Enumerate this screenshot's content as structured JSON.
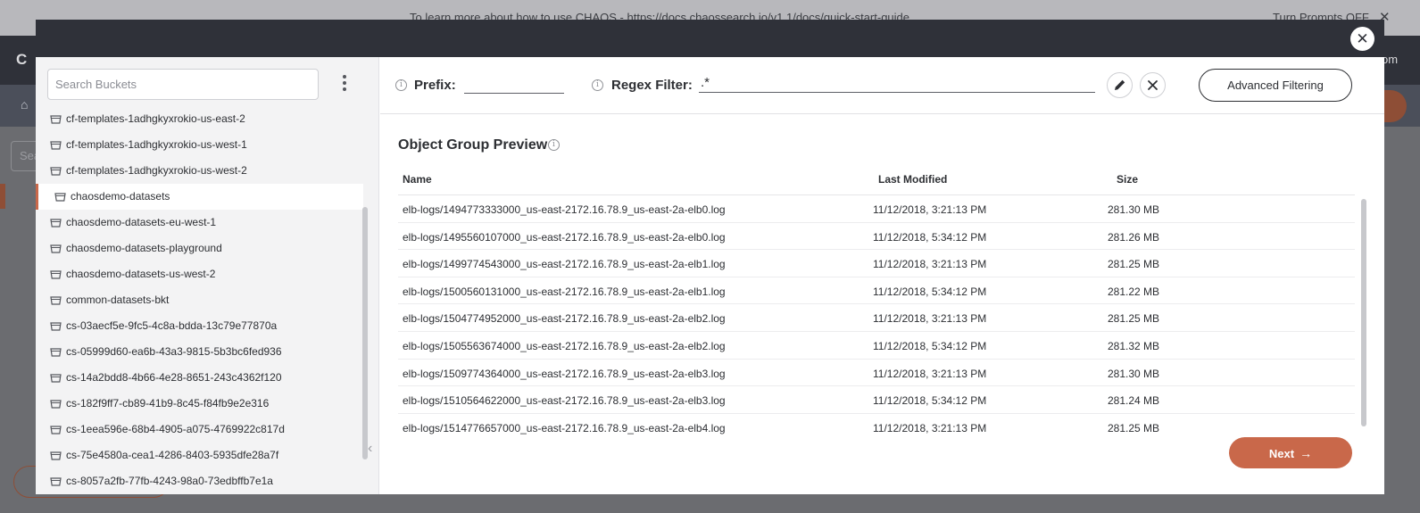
{
  "background": {
    "announcement": "To learn more about how to use CHAOS - https://docs.chaossearch.io/v1.1/docs/quick-start-guide",
    "prompts_toggle": "Turn Prompts OFF",
    "brand": "C H",
    "nav_right_fragment": "om",
    "search_fragment": "Sea"
  },
  "modal": {
    "close_icon": "close-icon",
    "search": {
      "placeholder": "Search Buckets",
      "value": ""
    },
    "buckets": [
      "cf-templates-1adhgkyxrokio-us-east-2",
      "cf-templates-1adhgkyxrokio-us-west-1",
      "cf-templates-1adhgkyxrokio-us-west-2",
      "chaosdemo-datasets",
      "chaosdemo-datasets-eu-west-1",
      "chaosdemo-datasets-playground",
      "chaosdemo-datasets-us-west-2",
      "common-datasets-bkt",
      "cs-03aecf5e-9fc5-4c8a-bdda-13c79e77870a",
      "cs-05999d60-ea6b-43a3-9815-5b3bc6fed936",
      "cs-14a2bdd8-4b66-4e28-8651-243c4362f120",
      "cs-182f9ff7-cb89-41b9-8c45-f84fb9e2e316",
      "cs-1eea596e-68b4-4905-a075-4769922c817d",
      "cs-75e4580a-cea1-4286-8403-5935dfe28a7f",
      "cs-8057a2fb-77fb-4243-98a0-73edbffb7e1a"
    ],
    "selected_bucket": "chaosdemo-datasets",
    "filters": {
      "prefix_label": "Prefix:",
      "prefix_value": "",
      "regex_label": "Regex Filter:",
      "regex_value": ".*",
      "advanced_label": "Advanced Filtering"
    },
    "preview": {
      "title": "Object Group Preview",
      "columns": [
        "Name",
        "Last Modified",
        "Size"
      ],
      "rows": [
        [
          "elb-logs/1494773333000_us-east-2172.16.78.9_us-east-2a-elb0.log",
          "11/12/2018, 3:21:13 PM",
          "281.30 MB"
        ],
        [
          "elb-logs/1495560107000_us-east-2172.16.78.9_us-east-2a-elb0.log",
          "11/12/2018, 5:34:12 PM",
          "281.26 MB"
        ],
        [
          "elb-logs/1499774543000_us-east-2172.16.78.9_us-east-2a-elb1.log",
          "11/12/2018, 3:21:13 PM",
          "281.25 MB"
        ],
        [
          "elb-logs/1500560131000_us-east-2172.16.78.9_us-east-2a-elb1.log",
          "11/12/2018, 5:34:12 PM",
          "281.22 MB"
        ],
        [
          "elb-logs/1504774952000_us-east-2172.16.78.9_us-east-2a-elb2.log",
          "11/12/2018, 3:21:13 PM",
          "281.25 MB"
        ],
        [
          "elb-logs/1505563674000_us-east-2172.16.78.9_us-east-2a-elb2.log",
          "11/12/2018, 5:34:12 PM",
          "281.32 MB"
        ],
        [
          "elb-logs/1509774364000_us-east-2172.16.78.9_us-east-2a-elb3.log",
          "11/12/2018, 3:21:13 PM",
          "281.30 MB"
        ],
        [
          "elb-logs/1510564622000_us-east-2172.16.78.9_us-east-2a-elb3.log",
          "11/12/2018, 5:34:12 PM",
          "281.24 MB"
        ],
        [
          "elb-logs/1514776657000_us-east-2172.16.78.9_us-east-2a-elb4.log",
          "11/12/2018, 3:21:13 PM",
          "281.25 MB"
        ]
      ]
    },
    "next_label": "Next"
  },
  "colors": {
    "accent": "#c9684a",
    "header": "#2f3139",
    "panel": "#f3f3f4"
  }
}
